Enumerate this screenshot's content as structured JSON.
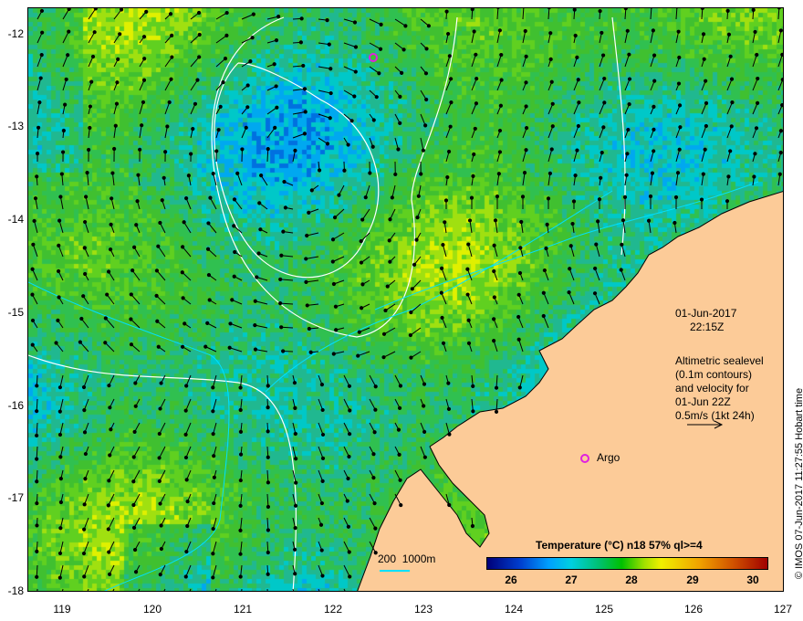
{
  "axes": {
    "y_ticks": [
      "-12",
      "-13",
      "-14",
      "-15",
      "-16",
      "-17",
      "-18"
    ],
    "x_ticks": [
      "119",
      "120",
      "121",
      "122",
      "123",
      "124",
      "125",
      "126",
      "127"
    ]
  },
  "annotation": {
    "date": "01-Jun-2017",
    "time": "22:15Z",
    "lines": [
      "Altimetric sealevel",
      "(0.1m contours)",
      "and velocity for",
      "01-Jun 22Z",
      "0.5m/s (1kt 24h)"
    ]
  },
  "argo_label": "Argo",
  "scale_label": "200  1000m",
  "colorbar": {
    "title": "Temperature (°C) n18 57% ql>=4",
    "ticks": [
      "26",
      "27",
      "28",
      "29",
      "30"
    ]
  },
  "copyright": "© IMOS 07-Jun-2017 11:27:55 Hobart time",
  "colors": {
    "land": "#fccb98",
    "argo": "#e020e0",
    "isobath": "#00e0ff"
  }
}
